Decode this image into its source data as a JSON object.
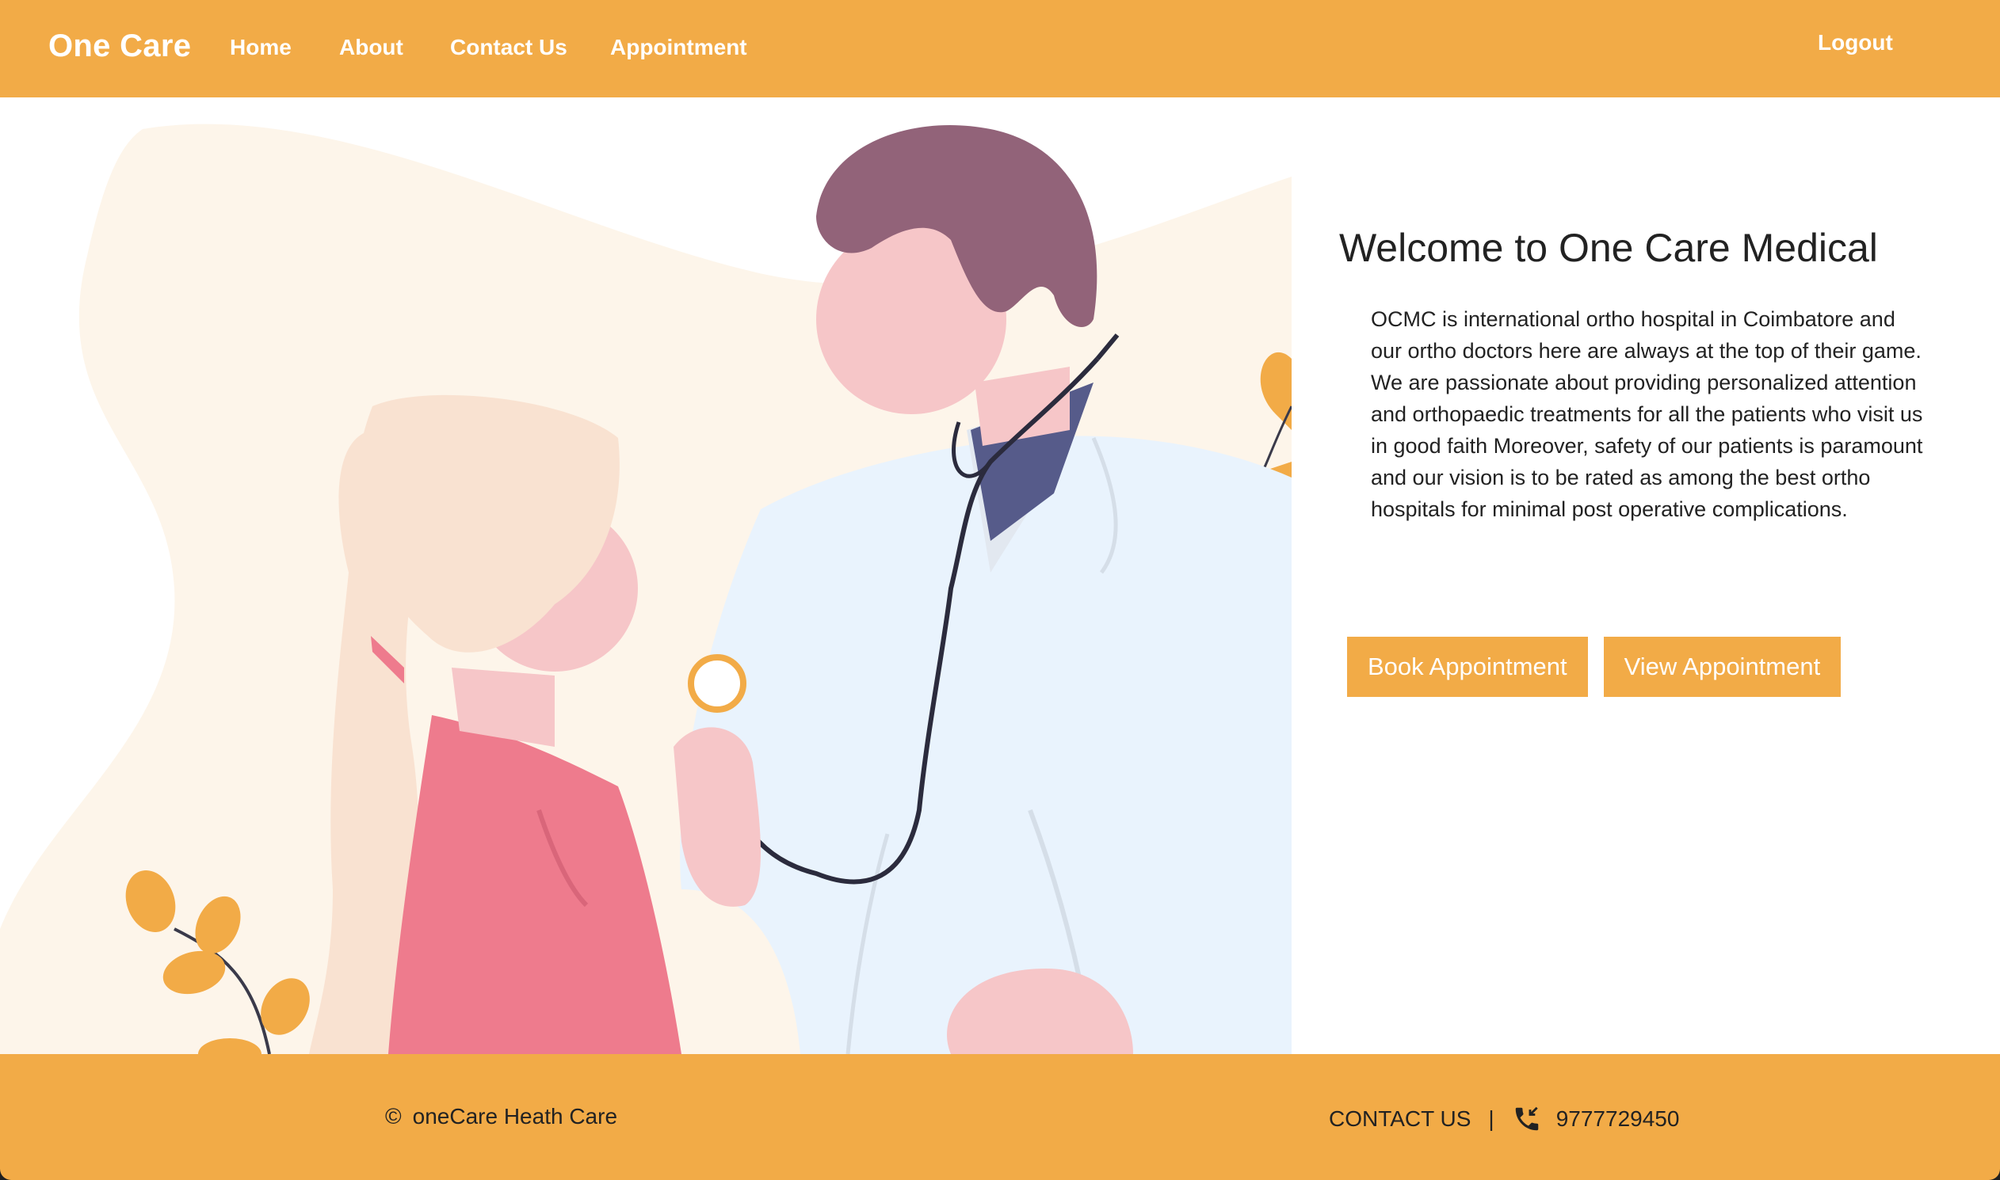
{
  "nav": {
    "brand": "One Care",
    "links": [
      "Home",
      "About",
      "Contact Us",
      "Appointment"
    ],
    "logout": "Logout"
  },
  "hero": {
    "title": "Welcome to One Care Medical",
    "description": "OCMC is international ortho hospital in Coimbatore and our ortho doctors here are always at the top of their game. We are passionate about providing personalized attention and orthopaedic treatments for all the patients who visit us in good faith Moreover, safety of our patients is paramount and our vision is to be rated as among the best ortho hospitals for minimal post operative complications.",
    "buttons": {
      "book": "Book Appointment",
      "view": "View Appointment"
    }
  },
  "footer": {
    "copyright_symbol": "©",
    "copyright_text": "oneCare Heath Care",
    "contact_label": "CONTACT US",
    "separator": "|",
    "phone": "9777729450"
  },
  "colors": {
    "accent": "#f2ab47",
    "text": "#222222"
  }
}
